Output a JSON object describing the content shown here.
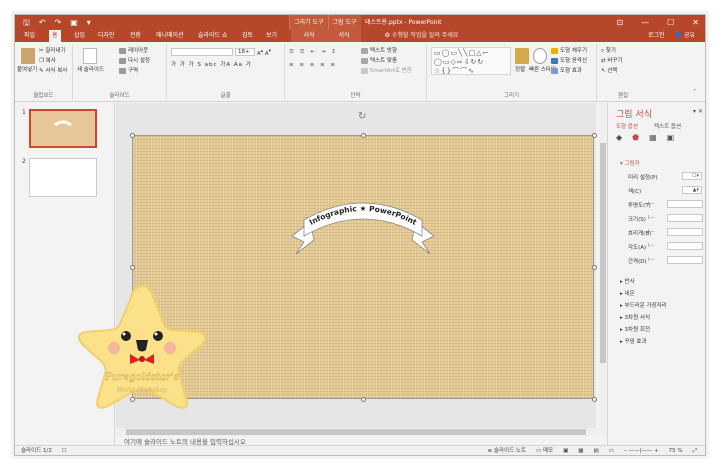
{
  "titlebar": {
    "doc_title": "테스트용.pptx - PowerPoint",
    "context_groups": [
      "그리기 도구",
      "그림 도구"
    ],
    "window_controls": [
      "⊡",
      "—",
      "☐",
      "✕"
    ]
  },
  "tabs": [
    {
      "label": "파일",
      "active": false
    },
    {
      "label": "홈",
      "active": true
    },
    {
      "label": "삽입",
      "active": false
    },
    {
      "label": "디자인",
      "active": false
    },
    {
      "label": "전환",
      "active": false
    },
    {
      "label": "애니메이션",
      "active": false
    },
    {
      "label": "슬라이드 쇼",
      "active": false
    },
    {
      "label": "검토",
      "active": false
    },
    {
      "label": "보기",
      "active": false
    },
    {
      "label": "서식",
      "active": false
    },
    {
      "label": "서식",
      "active": false
    }
  ],
  "tell_me": "수행할 작업을 알려 주세요",
  "account": {
    "login": "로그인",
    "share": "공유"
  },
  "ribbon": {
    "clipboard": {
      "label": "클립보드",
      "paste": "붙여넣기",
      "cut": "잘라내기",
      "copy": "복사",
      "format_painter": "서식 복사"
    },
    "slides": {
      "label": "슬라이드",
      "new_slide": "새 슬라이드",
      "layout": "레이아웃",
      "reset": "다시 설정",
      "section": "구역"
    },
    "font": {
      "label": "글꼴",
      "font_size": "18+",
      "letters": "가 가 가 S abc 가A Aa 가"
    },
    "paragraph": {
      "label": "단락",
      "text_direction": "텍스트 방향",
      "align_text": "텍스트 맞춤",
      "smartart": "SmartArt로 변환"
    },
    "drawing": {
      "label": "그리기",
      "arrange": "정렬",
      "quick_styles": "빠른 스타일",
      "fill": "도형 채우기",
      "outline": "도형 윤곽선",
      "effects": "도형 효과"
    },
    "editing": {
      "label": "편집",
      "find": "찾기",
      "replace": "바꾸기",
      "select": "선택"
    }
  },
  "thumbnails": [
    {
      "num": "1"
    },
    {
      "num": "2"
    }
  ],
  "slide": {
    "banner_text": "Infographic ★ PowerPoint"
  },
  "notes_placeholder": "여기에 슬라이드 노트의 내용을 입력하십시오",
  "format_pane": {
    "title": "그림 서식",
    "tabs": [
      "도형 옵션",
      "텍스트 옵션"
    ],
    "shadow_section": "그림자",
    "props": [
      {
        "label": "미리 설정(P)",
        "value": ""
      },
      {
        "label": "색(C)",
        "value": ""
      },
      {
        "label": "투명도(T)",
        "value": ""
      },
      {
        "label": "크기(S)",
        "value": ""
      },
      {
        "label": "흐리게(B)",
        "value": ""
      },
      {
        "label": "각도(A)",
        "value": ""
      },
      {
        "label": "간격(D)",
        "value": ""
      }
    ],
    "sections": [
      "반사",
      "네온",
      "부드러운 가장자리",
      "3차원 서식",
      "3차원 회전",
      "꾸밈 효과"
    ]
  },
  "statusbar": {
    "slide_info": "슬라이드 1/2",
    "notes": "슬라이드 노트",
    "comments": "메모",
    "zoom": "75 %"
  },
  "sticker": {
    "line1": "Puregoldstar's",
    "line2": "World Workshop"
  },
  "colors": {
    "accent": "#b7472a",
    "slide_bg": "#e3c892",
    "star": "#fbe28a"
  }
}
